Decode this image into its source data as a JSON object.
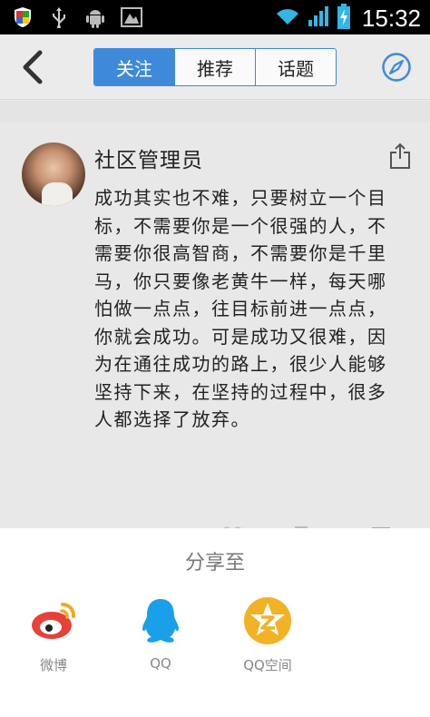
{
  "status_bar": {
    "time": "15:32",
    "icons": [
      "shield-icon",
      "usb-icon",
      "android-icon",
      "image-icon",
      "wifi-icon",
      "signal-icon",
      "battery-charging-icon"
    ]
  },
  "header": {
    "tabs": [
      {
        "label": "关注",
        "active": true
      },
      {
        "label": "推荐",
        "active": false
      },
      {
        "label": "话题",
        "active": false
      }
    ],
    "accent_color": "#3f8ad8"
  },
  "post": {
    "username": "社区管理员",
    "text": "成功其实也不难，只要树立一个目标，不需要你是一个很强的人，不需要你很高智商，不需要你是千里马，你只要像老黄牛一样，每天哪怕做一点点，往目标前进一点点，你就会成功。可是成功又很难，因为在通往成功的路上，很少人能够坚持下来，在坚持的过程中，很多人都选择了放弃。"
  },
  "share_sheet": {
    "title": "分享至",
    "items": [
      {
        "label": "微博",
        "icon": "weibo-icon",
        "color": "#e6423a"
      },
      {
        "label": "QQ",
        "icon": "qq-icon",
        "color": "#1aa0e8"
      },
      {
        "label": "QQ空间",
        "icon": "qzone-icon",
        "color": "#f1b226"
      }
    ]
  }
}
